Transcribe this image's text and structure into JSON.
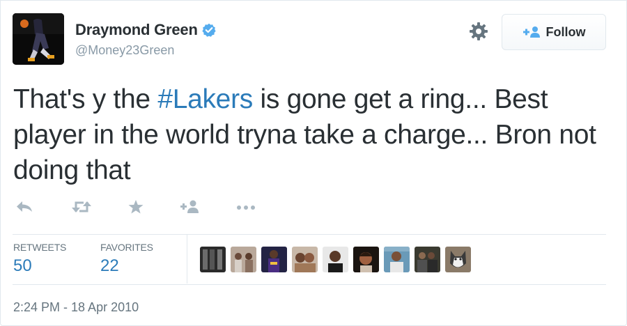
{
  "user": {
    "name": "Draymond Green",
    "handle": "@Money23Green",
    "verified": true
  },
  "follow_button": {
    "label": "Follow"
  },
  "tweet": {
    "text_before": "That's y the ",
    "hashtag": "#Lakers",
    "text_after": " is gone get a ring... Best player in the world tryna take a charge... Bron not doing that"
  },
  "actions": [
    "reply-icon",
    "retweet-icon",
    "favorite-icon",
    "follow-plus-icon",
    "more-icon"
  ],
  "stats": {
    "retweets": {
      "label": "RETWEETS",
      "value": "50"
    },
    "favorites": {
      "label": "FAVORITES",
      "value": "22"
    }
  },
  "favoriter_avatars": [
    "avatar-1",
    "avatar-2",
    "avatar-3",
    "avatar-4",
    "avatar-5",
    "avatar-6",
    "avatar-7",
    "avatar-8",
    "avatar-9",
    "avatar-10"
  ],
  "timestamp": "2:24 PM - 18 Apr 2010",
  "colors": {
    "link": "#2b7bb9",
    "verified": "#55acee",
    "muted": "#8899a6",
    "divider": "#e1e8ed"
  }
}
